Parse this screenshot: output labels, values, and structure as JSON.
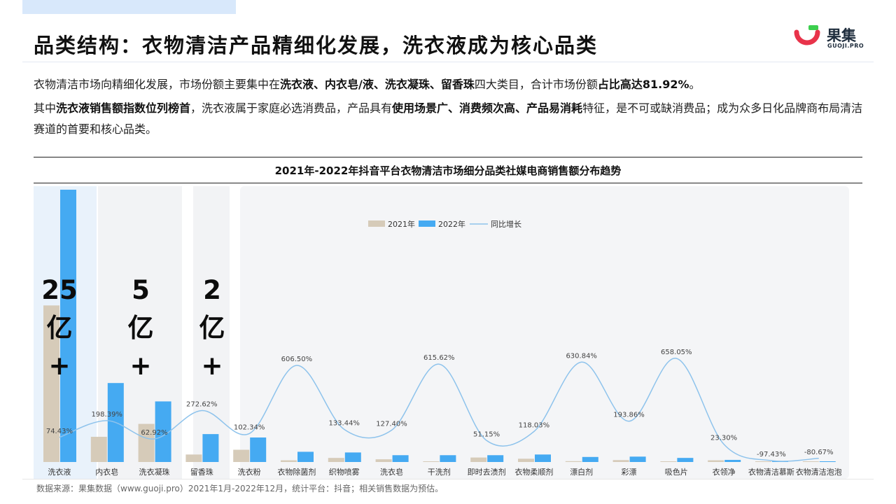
{
  "header": {
    "title": "品类结构：衣物清洁产品精细化发展，洗衣液成为核心品类",
    "logo_cn": "果集",
    "logo_en": "GUOJI.PRO"
  },
  "paragraph1": {
    "t1": "衣物清洁市场向精细化发展，市场份额主要集中在",
    "b1": "洗衣液、内衣皂/液、洗衣凝珠、留香珠",
    "t2": "四大类目，合计市场份额",
    "b2": "占比高达81.92%",
    "t3": "。"
  },
  "paragraph2": {
    "t1": "其中",
    "b1": "洗衣液销售额指数位列榜首",
    "t2": "，洗衣液属于家庭必选消费品，产品具有",
    "b2": "使用场景广、消费频次高、产品易消耗",
    "t3": "特征，是不可或缺消费品；成为众多日化品牌商布局清洁赛道的首要和核心品类。"
  },
  "badges": [
    {
      "text": "25\n亿\n+"
    },
    {
      "text": "5\n亿\n+"
    },
    {
      "text": "2\n亿\n+"
    }
  ],
  "footer": {
    "source": "数据来源：果集数据（www.guoji.pro）2021年1月-2022年12月，统计平台：抖音；相关销售数据为预估。"
  },
  "chart_data": {
    "type": "bar",
    "title": "2021年-2022年抖音平台衣物清洁市场细分品类社媒电商销售额分布趋势",
    "categories": [
      "洗衣液",
      "内衣皂",
      "洗衣凝珠",
      "留香珠",
      "洗衣粉",
      "衣物除菌剂",
      "织物喷雾",
      "洗衣皂",
      "干洗剂",
      "即时去渍剂",
      "衣物柔顺剂",
      "漂白剂",
      "彩漂",
      "吸色片",
      "衣领净",
      "衣物清洁慕斯",
      "衣物清洁泡泡"
    ],
    "series": [
      {
        "name": "2021年",
        "type": "bar",
        "color": "#d6cbb9",
        "values": [
          230,
          37,
          56,
          11,
          18,
          2.5,
          6,
          4,
          0.8,
          6.6,
          4.8,
          1.2,
          2.8,
          0.8,
          2.5,
          0.3,
          0.2
        ]
      },
      {
        "name": "2022年",
        "type": "bar",
        "color": "#45aaf2",
        "values": [
          400,
          116,
          89,
          41,
          36,
          15,
          14,
          10,
          10,
          10,
          11,
          7.4,
          7.9,
          6,
          3.1,
          0.008,
          0.04
        ]
      },
      {
        "name": "同比增长",
        "type": "line",
        "color": "#8ec3ec",
        "unit": "%",
        "values": [
          74.43,
          198.39,
          62.92,
          272.62,
          102.34,
          606.5,
          133.44,
          127.4,
          615.62,
          51.15,
          118.03,
          630.84,
          193.86,
          658.05,
          23.3,
          -97.43,
          -80.67
        ],
        "labels": [
          "74.43%",
          "198.39%",
          "62.92%",
          "272.62%",
          "102.34%",
          "606.50%",
          "133.44%",
          "127.40%",
          "615.62%",
          "51.15%",
          "118.03%",
          "630.84%",
          "193.86%",
          "658.05%",
          "23.30%",
          "-97.43%",
          "-80.67%"
        ]
      }
    ],
    "legend_position": "top-center",
    "grid": false
  }
}
